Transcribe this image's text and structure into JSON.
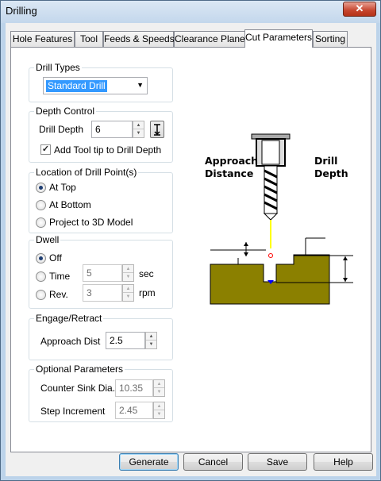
{
  "window": {
    "title": "Drilling",
    "close_glyph": "✕"
  },
  "tabs": [
    {
      "label": "Hole Features"
    },
    {
      "label": "Tool"
    },
    {
      "label": "Feeds & Speeds"
    },
    {
      "label": "Clearance Plane"
    },
    {
      "label": "Cut Parameters",
      "active": true
    },
    {
      "label": "Sorting"
    }
  ],
  "drill_types": {
    "title": "Drill Types",
    "selected": "Standard Drill"
  },
  "depth_control": {
    "title": "Depth Control",
    "drill_depth_label": "Drill Depth",
    "drill_depth_value": "6",
    "add_tool_tip_label": "Add Tool tip to Drill Depth",
    "add_tool_tip_checked": true
  },
  "location": {
    "title": "Location of Drill Point(s)",
    "options": [
      "At Top",
      "At Bottom",
      "Project to 3D Model"
    ],
    "selected": "At Top"
  },
  "dwell": {
    "title": "Dwell",
    "off_label": "Off",
    "time_label": "Time",
    "time_value": "5",
    "time_unit": "sec",
    "rev_label": "Rev.",
    "rev_value": "3",
    "rev_unit": "rpm",
    "selected": "Off"
  },
  "engage": {
    "title": "Engage/Retract",
    "approach_label": "Approach Dist",
    "approach_value": "2.5"
  },
  "optional": {
    "title": "Optional Parameters",
    "counter_sink_label": "Counter Sink Dia.",
    "counter_sink_value": "10.35",
    "step_label": "Step Increment",
    "step_value": "2.45"
  },
  "diagram": {
    "approach_label_line1": "Approach",
    "approach_label_line2": "Distance",
    "depth_label_line1": "Drill",
    "depth_label_line2": "Depth",
    "colors": {
      "stock": "#8b8000",
      "tool_tip_line": "#ffff00",
      "bottom_marker": "#0000ff"
    }
  },
  "buttons": {
    "generate": "Generate",
    "cancel": "Cancel",
    "save": "Save",
    "help": "Help"
  }
}
